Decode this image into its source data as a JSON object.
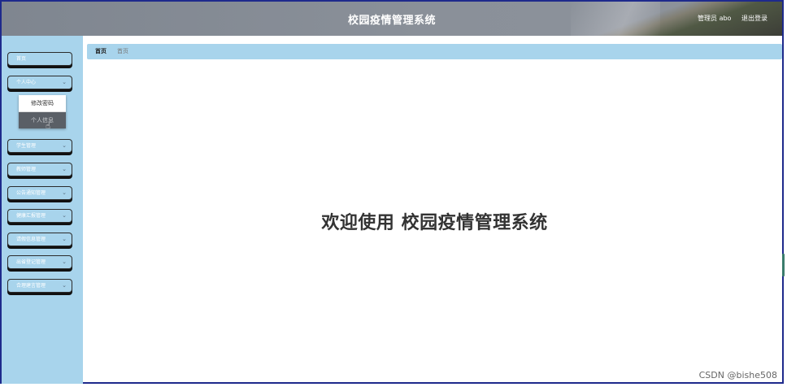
{
  "header": {
    "title": "校园疫情管理系统",
    "user_label": "管理员 abo",
    "logout_label": "退出登录"
  },
  "sidebar": {
    "items": [
      {
        "label": "首页"
      },
      {
        "label": "个人中心"
      },
      {
        "label": "学生管理"
      },
      {
        "label": "教师管理"
      },
      {
        "label": "公告通知管理"
      },
      {
        "label": "健康汇报管理"
      },
      {
        "label": "请假信息管理"
      },
      {
        "label": "出省登记管理"
      },
      {
        "label": "合理建言管理"
      }
    ],
    "submenu": [
      {
        "label": "修改密码"
      },
      {
        "label": "个人信息"
      }
    ]
  },
  "breadcrumb": {
    "home": "首页",
    "current": "首页"
  },
  "main": {
    "welcome": "欢迎使用 校园疫情管理系统"
  },
  "watermark": "CSDN @bishe508",
  "colors": {
    "header_bg": "#8a9099",
    "sidebar_bg": "#a8d4ec",
    "frame_border": "#1e2a8c"
  }
}
